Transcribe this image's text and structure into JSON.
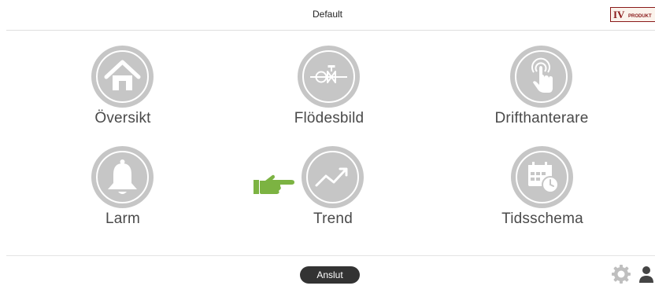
{
  "header": {
    "title": "Default",
    "logo_text": "IV PRODUKT"
  },
  "menu": {
    "items": [
      {
        "label": "Översikt",
        "icon": "home-icon"
      },
      {
        "label": "Flödesbild",
        "icon": "flow-diagram-icon"
      },
      {
        "label": "Drifthanterare",
        "icon": "touch-hand-icon"
      },
      {
        "label": "Larm",
        "icon": "bell-icon"
      },
      {
        "label": "Trend",
        "icon": "trend-chart-icon"
      },
      {
        "label": "Tidsschema",
        "icon": "calendar-clock-icon"
      }
    ]
  },
  "pointer": {
    "icon": "pointing-hand-icon",
    "color": "#7cb342"
  },
  "footer": {
    "connect_label": "Anslut",
    "settings_icon": "gear-icon",
    "user_icon": "user-icon"
  },
  "colors": {
    "tile_circle": "#c6c6c6",
    "button_bg": "#333333",
    "pointer": "#7cb342"
  }
}
